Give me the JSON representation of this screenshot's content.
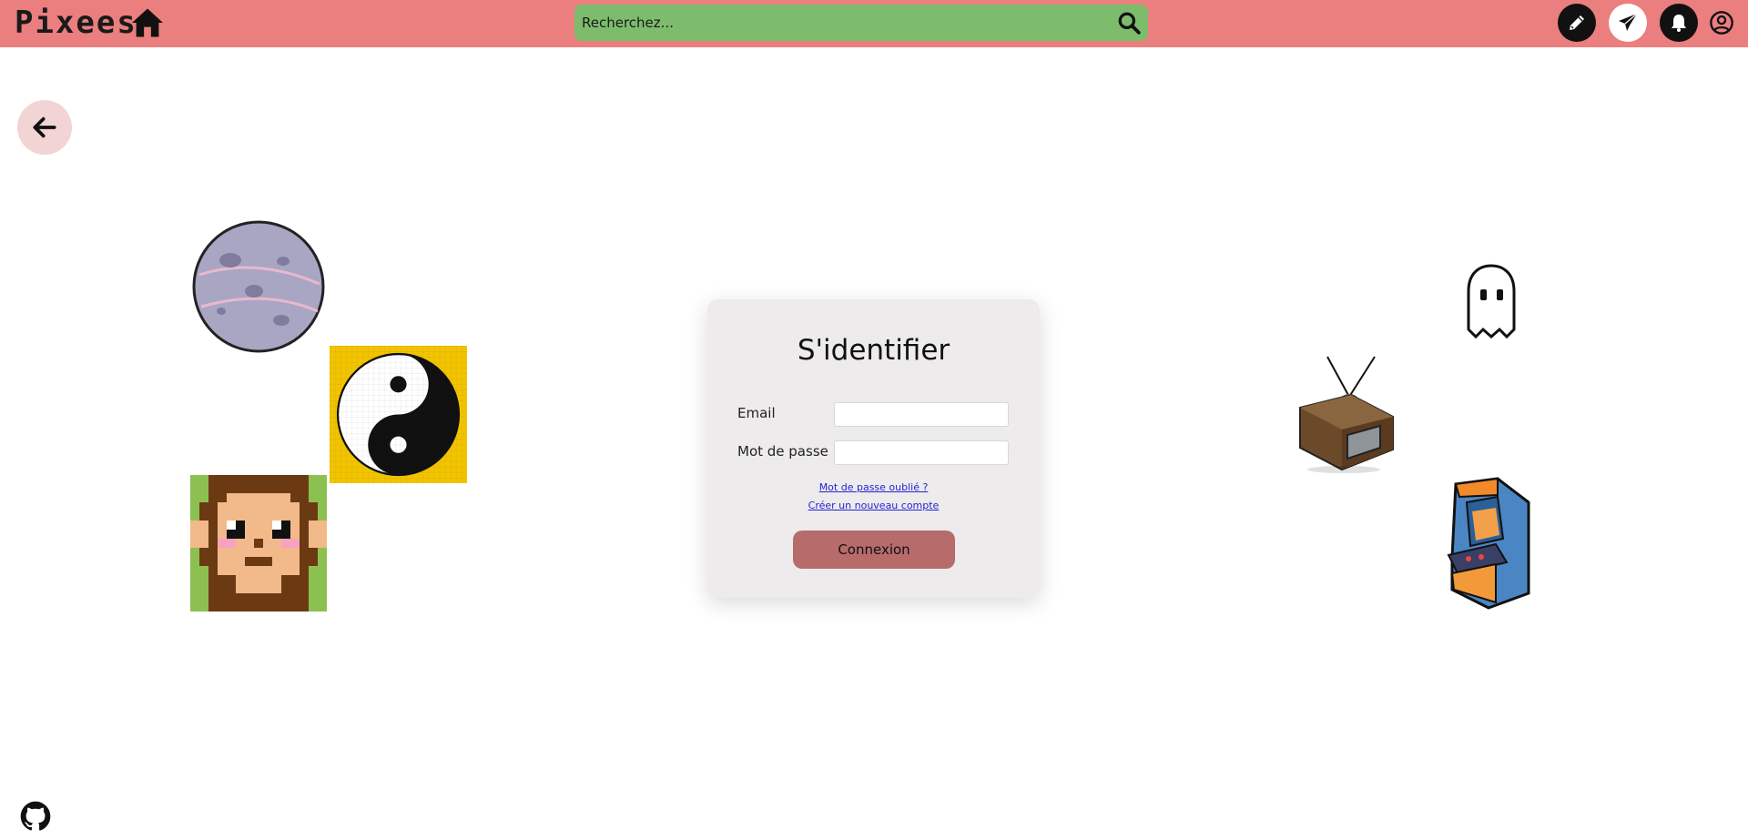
{
  "header": {
    "logo": "Pixees",
    "search": {
      "placeholder": "Recherchez..."
    }
  },
  "login": {
    "title": "S'identifier",
    "email_label": "Email",
    "password_label": "Mot de passe",
    "forgot_link": "Mot de passe oublié ?",
    "create_link": "Créer un nouveau compte",
    "submit_label": "Connexion"
  },
  "icons": {
    "home": "home-icon",
    "search": "search-icon",
    "create": "pencil-icon",
    "messages": "paper-plane-icon",
    "notifications": "bell-icon",
    "account": "user-circle-icon",
    "back": "arrow-left-icon",
    "github": "github-icon"
  },
  "colors": {
    "header_bg": "#eb7e7e",
    "search_bg": "#7cbc6c",
    "card_bg": "#edebeb",
    "button_bg": "#b76b6b",
    "back_btn_bg": "#f3d4d4"
  }
}
